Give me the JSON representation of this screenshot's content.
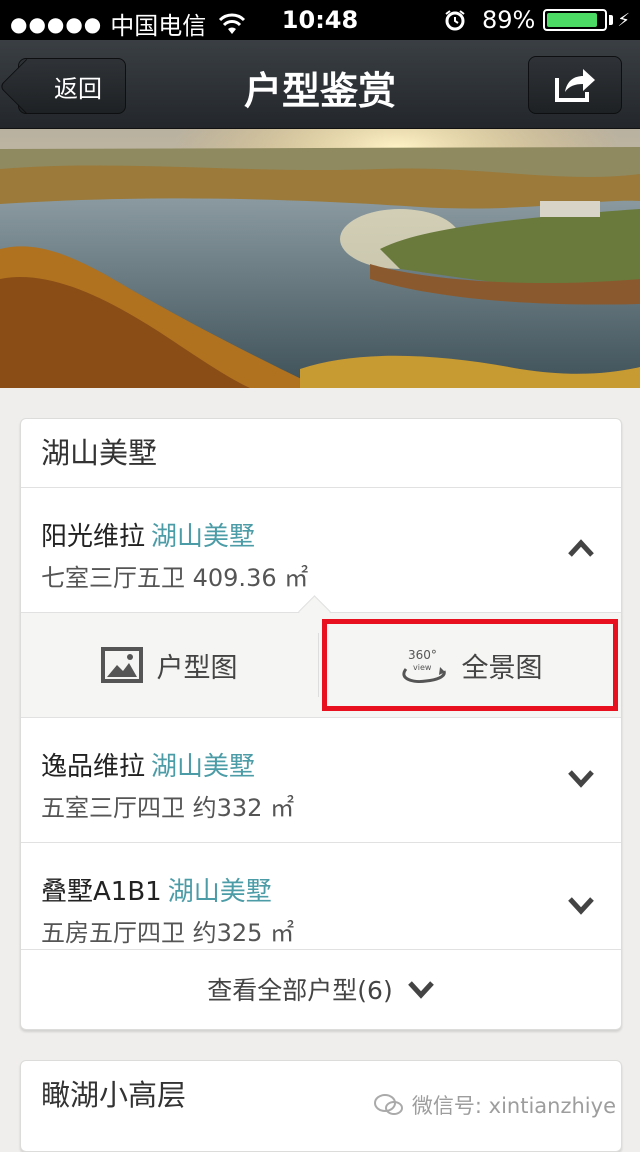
{
  "status": {
    "signal": "●●●●●",
    "carrier": "中国电信",
    "time": "10:48",
    "battery": "89%",
    "battery_level": 0.89,
    "icons": [
      "wifi-icon",
      "alarm-icon",
      "battery-icon",
      "charging-icon"
    ]
  },
  "nav": {
    "back": "返回",
    "title": "户型鉴赏",
    "share_icon": "share-icon"
  },
  "hero": {
    "image": "lake-landscape"
  },
  "section1": {
    "title": "湖山美墅",
    "units": [
      {
        "name": "阳光维拉",
        "tag": "湖山美墅",
        "detail": "七室三厅五卫 409.36 ㎡",
        "state": "expanded"
      },
      {
        "name": "逸品维拉",
        "tag": "湖山美墅",
        "detail": "五室三厅四卫 约332 ㎡",
        "state": "collapsed"
      },
      {
        "name": "叠墅A1B1",
        "tag": "湖山美墅",
        "detail": "五房五厅四卫 约325 ㎡",
        "state": "collapsed"
      }
    ],
    "options": {
      "floorplan": "户型图",
      "panorama": "全景图",
      "panorama_badge": "360° view"
    },
    "more": "查看全部户型(6)"
  },
  "section2": {
    "title": "瞰湖小高层"
  },
  "watermark": "微信号: xintianzhiye",
  "colors": {
    "navbar": "#2b2f33",
    "tag": "#4c9ca7",
    "highlight": "#e8101e",
    "battery": "#4cd964"
  }
}
